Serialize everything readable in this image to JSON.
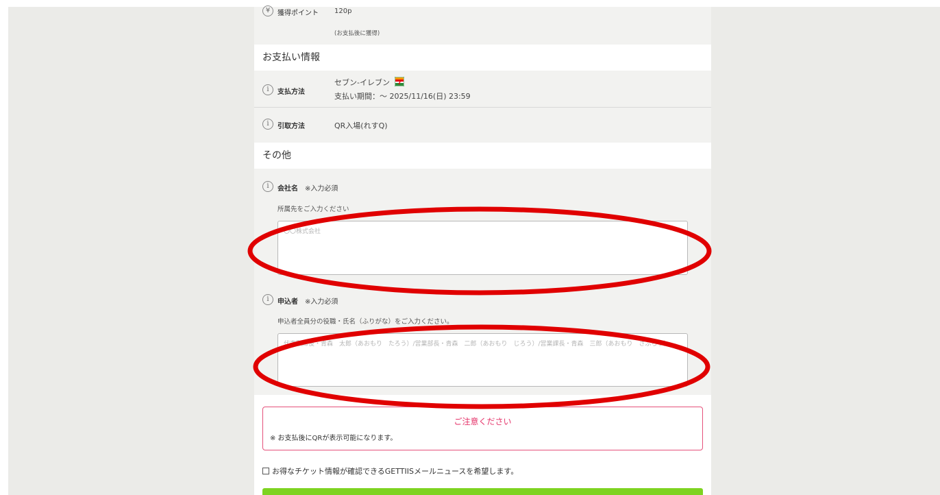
{
  "points": {
    "label": "獲得ポイント",
    "value": "120p",
    "note": "(お支払後に獲得)"
  },
  "payment_section": {
    "title": "お支払い情報",
    "method_label": "支払方法",
    "method_value": "セブン-イレブン",
    "deadline": "支払い期間：～ 2025/11/16(日) 23:59",
    "pickup_label": "引取方法",
    "pickup_value": "QR入場(れすQ)"
  },
  "other_section": {
    "title": "その他",
    "company": {
      "label": "会社名",
      "required": "※入力必須",
      "description": "所属先をご入力ください",
      "placeholder": "〇〇株式会社"
    },
    "applicant": {
      "label": "申込者",
      "required": "※入力必須",
      "description": "申込者全員分の役職・氏名（ふりがな）をご入力ください。",
      "placeholder": "代表取締役・青森　太郎（あおもり　たろう）/営業部長・青森　二郎（あおもり　じろう）/営業課長・青森　三郎（あおもり　さぶろう）"
    }
  },
  "notice": {
    "title": "ご注意ください",
    "body": "※ お支払後にQRが表示可能になります。"
  },
  "newsletter_label": "お得なチケット情報が確認できるGETTIISメールニュースを希望します。",
  "colors": {
    "annotation": "#e00000",
    "notice_border": "#e5507a",
    "button": "#7ed321"
  }
}
